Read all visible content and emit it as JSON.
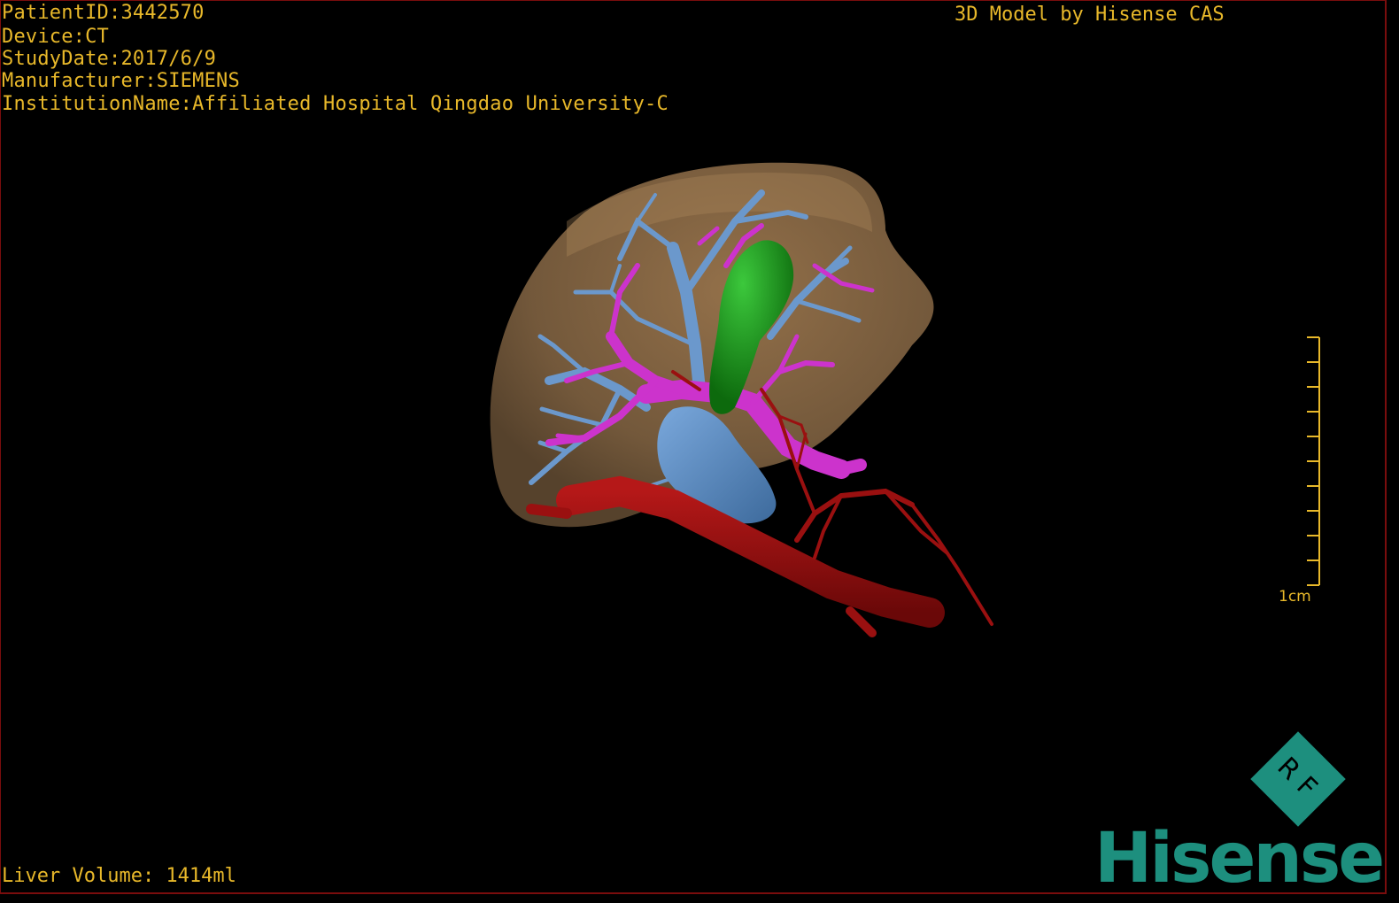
{
  "overlay": {
    "patient_id": "PatientID:3442570",
    "device": "Device:CT",
    "study_date": "StudyDate:2017/6/9",
    "manufacturer": "Manufacturer:SIEMENS",
    "institution": "InstitutionName:Affiliated Hospital Qingdao University-C",
    "brand": "3D Model by Hisense CAS",
    "liver_volume": "Liver Volume: 1414ml"
  },
  "scale_bar": {
    "label": "1cm",
    "tick_count": 10
  },
  "logo": {
    "badge_text": "RF",
    "wordmark": "Hisense"
  },
  "colors": {
    "text": "#e8b82a",
    "frame": "#7a0d0d",
    "background": "#000000",
    "liver": "#8a6a45",
    "portal_vein": "#cc33cc",
    "hepatic_vein": "#6b98cc",
    "artery": "#9a1010",
    "gallbladder": "#1a8c1a",
    "logo": "#1d8f7e"
  }
}
